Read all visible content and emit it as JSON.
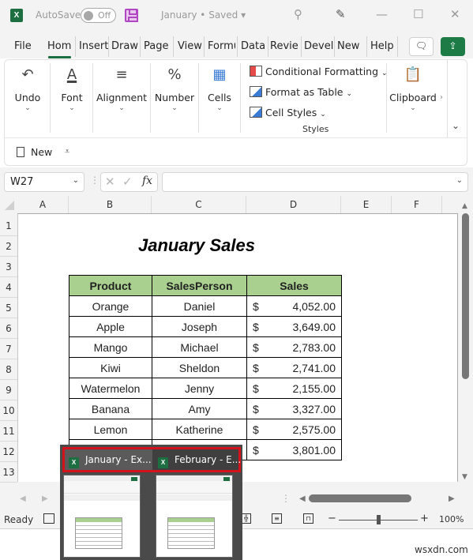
{
  "titlebar": {
    "app_icon": "excel-logo-icon",
    "autosave_label": "AutoSave",
    "autosave_state": "Off",
    "doc_title": "January • Saved",
    "doc_title_chevron": "▾",
    "icons": [
      "search-icon",
      "designer-icon",
      "minimize-icon",
      "maximize-icon",
      "close-icon"
    ]
  },
  "tabs": {
    "items": [
      "File",
      "Home",
      "Insert",
      "Draw",
      "Page",
      "View",
      "Formu",
      "Data",
      "Revie",
      "Devel",
      "New ",
      "Help"
    ],
    "active": "Home"
  },
  "ribbon": {
    "groups": [
      {
        "label": "Undo",
        "icon": "undo-icon"
      },
      {
        "label": "Font",
        "icon": "font-color-icon"
      },
      {
        "label": "Alignment",
        "icon": "align-center-icon"
      },
      {
        "label": "Number",
        "icon": "percent-icon"
      },
      {
        "label": "Cells",
        "icon": "cells-icon"
      }
    ],
    "styles": {
      "items": [
        "Conditional Formatting",
        "Format as Table",
        "Cell Styles"
      ],
      "group_label": "Styles"
    },
    "clipboard": {
      "label": "Clipboard",
      "icon": "clipboard-icon"
    }
  },
  "quick_access": {
    "new_label": "New",
    "more_icon": "customize-qat-icon"
  },
  "formula_bar": {
    "name_box": "W27",
    "formula_value": "",
    "fx_label": "fx"
  },
  "grid": {
    "columns": [
      "A",
      "B",
      "C",
      "D",
      "E",
      "F"
    ],
    "rows": [
      "1",
      "2",
      "3",
      "4",
      "5",
      "6",
      "7",
      "8",
      "9",
      "10",
      "11",
      "12",
      "13"
    ]
  },
  "sheet": {
    "title": "January Sales",
    "headers": [
      "Product",
      "SalesPerson",
      "Sales"
    ],
    "currency_symbol": "$",
    "rows": [
      {
        "product": "Orange",
        "person": "Daniel",
        "sales": "4,052.00"
      },
      {
        "product": "Apple",
        "person": "Joseph",
        "sales": "3,649.00"
      },
      {
        "product": "Mango",
        "person": "Michael",
        "sales": "2,783.00"
      },
      {
        "product": "Kiwi",
        "person": "Sheldon",
        "sales": "2,741.00"
      },
      {
        "product": "Watermelon",
        "person": "Jenny",
        "sales": "2,155.00"
      },
      {
        "product": "Banana",
        "person": "Amy",
        "sales": "3,327.00"
      },
      {
        "product": "Lemon",
        "person": "Katherine",
        "sales": "2,575.00"
      },
      {
        "product": "",
        "person": "",
        "sales": "3,801.00"
      }
    ]
  },
  "statusbar": {
    "ready": "Ready",
    "zoom": "100%"
  },
  "taskbar_preview": {
    "windows": [
      {
        "label": "January - Ex...",
        "active": true
      },
      {
        "label": "February - E...",
        "active": false
      }
    ],
    "highlight_color": "#d2131b"
  },
  "watermark": "wsxdn.com",
  "colors": {
    "accent": "#1d6f42",
    "header_fill": "#a9d08e"
  }
}
